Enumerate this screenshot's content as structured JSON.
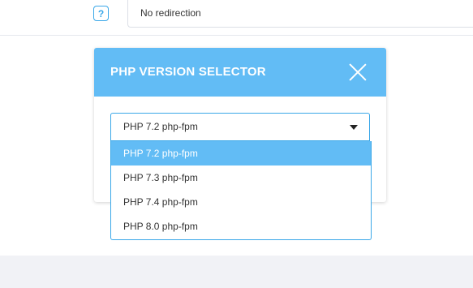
{
  "redirect": {
    "help_glyph": "?",
    "value": "No redirection"
  },
  "modal": {
    "title": "PHP VERSION SELECTOR",
    "header_color": "#62bcf5"
  },
  "php_select": {
    "selected_value": "PHP 7.2 php-fpm",
    "options": [
      {
        "label": "PHP 7.2 php-fpm",
        "highlighted": true
      },
      {
        "label": "PHP 7.3 php-fpm",
        "highlighted": false
      },
      {
        "label": "PHP 7.4 php-fpm",
        "highlighted": false
      },
      {
        "label": "PHP 8.0 php-fpm",
        "highlighted": false
      }
    ]
  },
  "colors": {
    "accent": "#3aa7e8",
    "highlight": "#62bcf5"
  }
}
